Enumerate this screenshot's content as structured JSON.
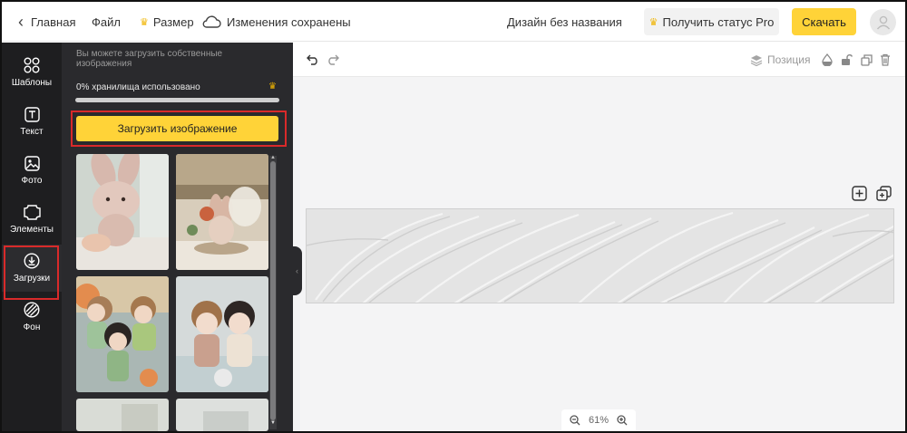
{
  "topbar": {
    "home_label": "Главная",
    "file_label": "Файл",
    "size_label": "Размер",
    "saved_status": "Изменения сохранены",
    "design_name": "Дизайн без названия",
    "pro_label": "Получить статус Pro",
    "download_label": "Скачать"
  },
  "sidebar": {
    "items": [
      {
        "label": "Шаблоны",
        "icon": "grid-icon"
      },
      {
        "label": "Текст",
        "icon": "text-icon"
      },
      {
        "label": "Фото",
        "icon": "image-icon"
      },
      {
        "label": "Элементы",
        "icon": "elements-icon"
      },
      {
        "label": "Загрузки",
        "icon": "upload-icon",
        "active": true
      },
      {
        "label": "Фон",
        "icon": "background-icon"
      }
    ]
  },
  "uploads": {
    "hint": "Вы можете загрузить собственные изображения",
    "storage_text": "0% хранилища использовано",
    "storage_used_fraction": 0,
    "upload_button": "Загрузить изображение"
  },
  "toolbar": {
    "position_label": "Позиция"
  },
  "zoom": {
    "level": "61%"
  },
  "colors": {
    "accent_yellow": "#ffd338",
    "crown": "#f0b400",
    "panel_dark": "#2a2a2d",
    "rail_dark": "#1e1e20",
    "highlight_red": "#d92a2a"
  }
}
